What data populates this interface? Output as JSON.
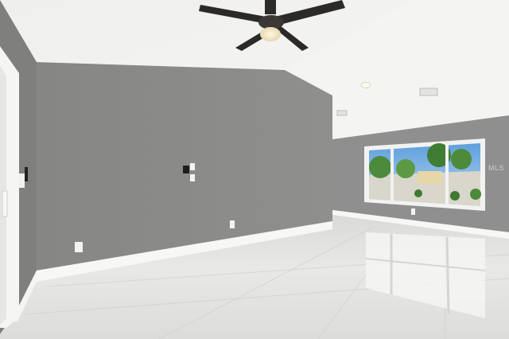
{
  "scene": {
    "description_colors": {
      "ceiling": "#f3f3f1",
      "wall_left_front": "#8b8b89",
      "wall_side_left": "#7d7e7c",
      "wall_right": "#8e8f8e",
      "floor": "#e6e6e4",
      "baseboard": "#f7f7f5",
      "window_frame": "#f2f2f0",
      "sky": "#7fb4e3",
      "foliage": "#4f8a3a",
      "fan_body": "#2c2a28",
      "fan_light": "#f3e9cf"
    },
    "objects": [
      {
        "name": "ceiling-fan",
        "icon": "ceiling-fan-icon"
      },
      {
        "name": "recessed-light",
        "icon": "recessed-light-icon"
      },
      {
        "name": "air-vent",
        "icon": "vent-icon"
      },
      {
        "name": "thermostat",
        "icon": "thermostat-icon"
      },
      {
        "name": "light-switch",
        "icon": "switch-icon"
      },
      {
        "name": "electrical-outlet",
        "icon": "outlet-icon"
      },
      {
        "name": "window",
        "icon": "window-icon"
      },
      {
        "name": "door-frame",
        "icon": "door-icon"
      }
    ]
  },
  "watermark": {
    "text": "MLS"
  }
}
